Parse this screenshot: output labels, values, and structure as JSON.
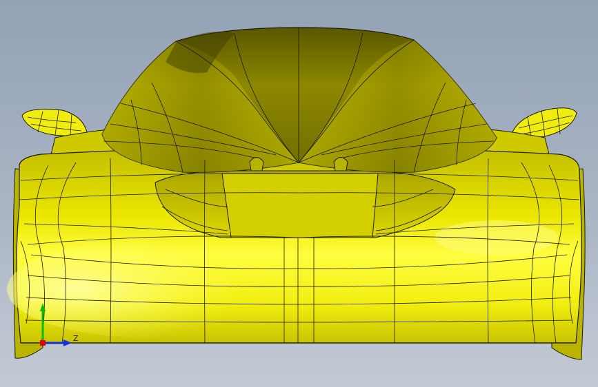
{
  "viewport": {
    "background_top": "#94a2b5",
    "background_bottom": "#c3cad5"
  },
  "model": {
    "shade_color": "#e6e200",
    "edge_color": "#1c1c00"
  },
  "triad": {
    "labels": {
      "z": "Z"
    },
    "colors": {
      "x": "#e00000",
      "y": "#00c000",
      "z": "#1030e0"
    }
  }
}
